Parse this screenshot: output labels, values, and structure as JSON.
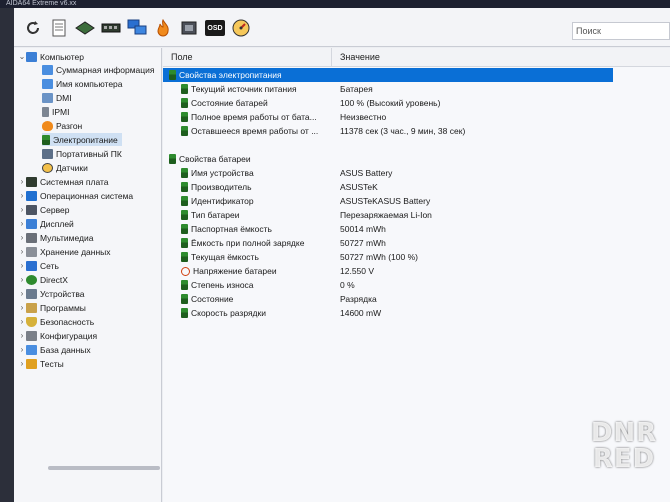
{
  "title_bar": {
    "text": "AIDA64 Extreme v6.xx"
  },
  "search": {
    "placeholder": "Поиск"
  },
  "toolbar": {
    "icons": [
      "refresh-icon",
      "report-icon",
      "motherboard-icon",
      "memory-icon",
      "network-icon",
      "flame-icon",
      "chip-icon",
      "osd-icon",
      "gauge-icon"
    ],
    "osd_label": "OSD"
  },
  "tree": {
    "root": "Компьютер",
    "computer_children": [
      "Суммарная информация",
      "Имя компьютера",
      "DMI",
      "IPMI",
      "Разгон",
      "Электропитание",
      "Портативный ПК",
      "Датчики"
    ],
    "categories": [
      "Системная плата",
      "Операционная система",
      "Сервер",
      "Дисплей",
      "Мультимедиа",
      "Хранение данных",
      "Сеть",
      "DirectX",
      "Устройства",
      "Программы",
      "Безопасность",
      "Конфигурация",
      "База данных",
      "Тесты"
    ]
  },
  "columns": {
    "field": "Поле",
    "value": "Значение"
  },
  "sections": [
    {
      "title": "Свойства электропитания",
      "rows": [
        {
          "field": "Текущий источник питания",
          "value": "Батарея"
        },
        {
          "field": "Состояние батарей",
          "value": "100 % (Высокий уровень)"
        },
        {
          "field": "Полное время работы от бата...",
          "value": "Неизвестно"
        },
        {
          "field": "Оставшееся время работы от ...",
          "value": "11378 сек (3 час., 9 мин, 38 сек)"
        }
      ]
    },
    {
      "title": "Свойства батареи",
      "rows": [
        {
          "field": "Имя устройства",
          "value": "ASUS Battery"
        },
        {
          "field": "Производитель",
          "value": "ASUSTeK"
        },
        {
          "field": "Идентификатор",
          "value": "ASUSTeKASUS Battery"
        },
        {
          "field": "Тип батареи",
          "value": "Перезаряжаемая Li-Ion"
        },
        {
          "field": "Паспортная ёмкость",
          "value": "50014 mWh"
        },
        {
          "field": "Ёмкость при полной зарядке",
          "value": "50727 mWh"
        },
        {
          "field": "Текущая ёмкость",
          "value": "50727 mWh  (100 %)"
        },
        {
          "field": "Напряжение батареи",
          "value": "12.550 V"
        },
        {
          "field": "Степень износа",
          "value": "0 %"
        },
        {
          "field": "Состояние",
          "value": "Разрядка"
        },
        {
          "field": "Скорость разрядки",
          "value": "14600 mW"
        }
      ]
    }
  ],
  "watermark": {
    "line1": "DNR",
    "line2": "RED"
  }
}
